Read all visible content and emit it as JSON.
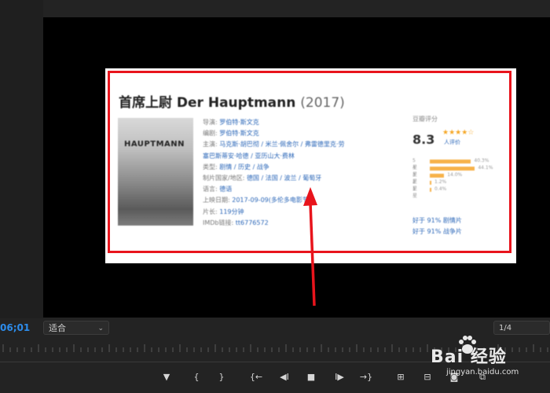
{
  "monitor": {
    "timecode": "06;01",
    "fit_label": "适合",
    "resolution": "1/4"
  },
  "movie": {
    "title": "首席上尉 Der Hauptmann",
    "year": "(2017)",
    "poster_text": "HAUPTMANN",
    "info_lines": [
      {
        "k": "导演:",
        "v": "罗伯特·斯文克"
      },
      {
        "k": "编剧:",
        "v": "罗伯特·斯文克"
      },
      {
        "k": "主演:",
        "v": "马克斯·胡巴彻 / 米兰·佩舍尔 / 弗雷德里克·劳"
      },
      {
        "k": "",
        "v": "塞巴斯蒂安·哈德 / 亚历山大·费林"
      },
      {
        "k": "类型:",
        "v": "剧情 / 历史 / 战争"
      },
      {
        "k": "制片国家/地区:",
        "v": "德国 / 法国 / 波兰 / 葡萄牙"
      },
      {
        "k": "语言:",
        "v": "德语"
      },
      {
        "k": "上映日期:",
        "v": "2017-09-09(多伦多电影节)"
      },
      {
        "k": "片长:",
        "v": "119分钟"
      },
      {
        "k": "IMDb链接:",
        "v": "tt6776572"
      }
    ],
    "rating": {
      "label": "豆瓣评分",
      "score": "8.3",
      "stars": "★★★★☆",
      "votes": "人评价",
      "bars": [
        {
          "label": "5星",
          "pct": "40.3%"
        },
        {
          "label": "4星",
          "pct": "44.1%"
        },
        {
          "label": "3星",
          "pct": "14.0%"
        },
        {
          "label": "2星",
          "pct": "1.2%"
        },
        {
          "label": "1星",
          "pct": "0.4%"
        }
      ],
      "better_lines": [
        "好于 91% 剧情片",
        "好于 91% 战争片"
      ]
    }
  },
  "transport": {
    "marker": "▼",
    "in_point": "{",
    "out_point": "}",
    "go_in": "{←",
    "step_back": "◀I",
    "stop": "■",
    "step_fwd": "I▶",
    "go_out": "→}",
    "insert": "⊞",
    "overwrite": "⊟",
    "camera": "◙",
    "compare": "⧉"
  },
  "watermark": {
    "text": "Bai 经验",
    "sub": "jingyan.baidu.com"
  },
  "colors": {
    "accent_timecode": "#2d8ceb",
    "highlight_box": "#e8141c",
    "arrow": "#e8141c"
  }
}
